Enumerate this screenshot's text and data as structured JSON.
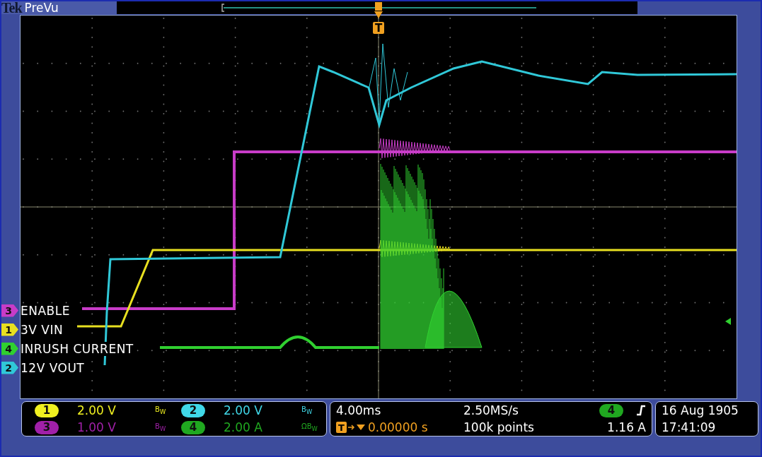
{
  "header": {
    "brand": "Tek",
    "mode": "PreVu"
  },
  "trigger_marker": {
    "label": "T"
  },
  "traces": [
    {
      "channel": "3",
      "label": "ENABLE",
      "color": "#c83cc8"
    },
    {
      "channel": "1",
      "label": "3V VIN",
      "color": "#e8e020"
    },
    {
      "channel": "4",
      "label": "INRUSH CURRENT",
      "color": "#30d030"
    },
    {
      "channel": "2",
      "label": "12V VOUT",
      "color": "#30c8d8"
    }
  ],
  "channel_readouts": [
    {
      "channel": "1",
      "scale": "2.00 V",
      "bandwidth": "B$_{W}$",
      "color": "#f0f020"
    },
    {
      "channel": "2",
      "scale": "2.00 V",
      "bandwidth": "B$_{W}$",
      "color": "#40d8e8"
    },
    {
      "channel": "3",
      "scale": "1.00 V",
      "bandwidth": "B$_{W}$",
      "color": "#a020a8"
    },
    {
      "channel": "4",
      "scale": "2.00 A",
      "bandwidth": "ΩB$_{W}$",
      "color": "#20a820"
    }
  ],
  "timebase": {
    "scale": "4.00ms",
    "trigger_badge": "T",
    "position": "0.00000 s",
    "sample_rate": "2.50MS/s",
    "record_length": "100k points"
  },
  "trigger": {
    "channel": "4",
    "color": "#20a820",
    "reading": "1.16 A"
  },
  "datetime": {
    "date": "16 Aug 1905",
    "time": "17:41:09"
  }
}
